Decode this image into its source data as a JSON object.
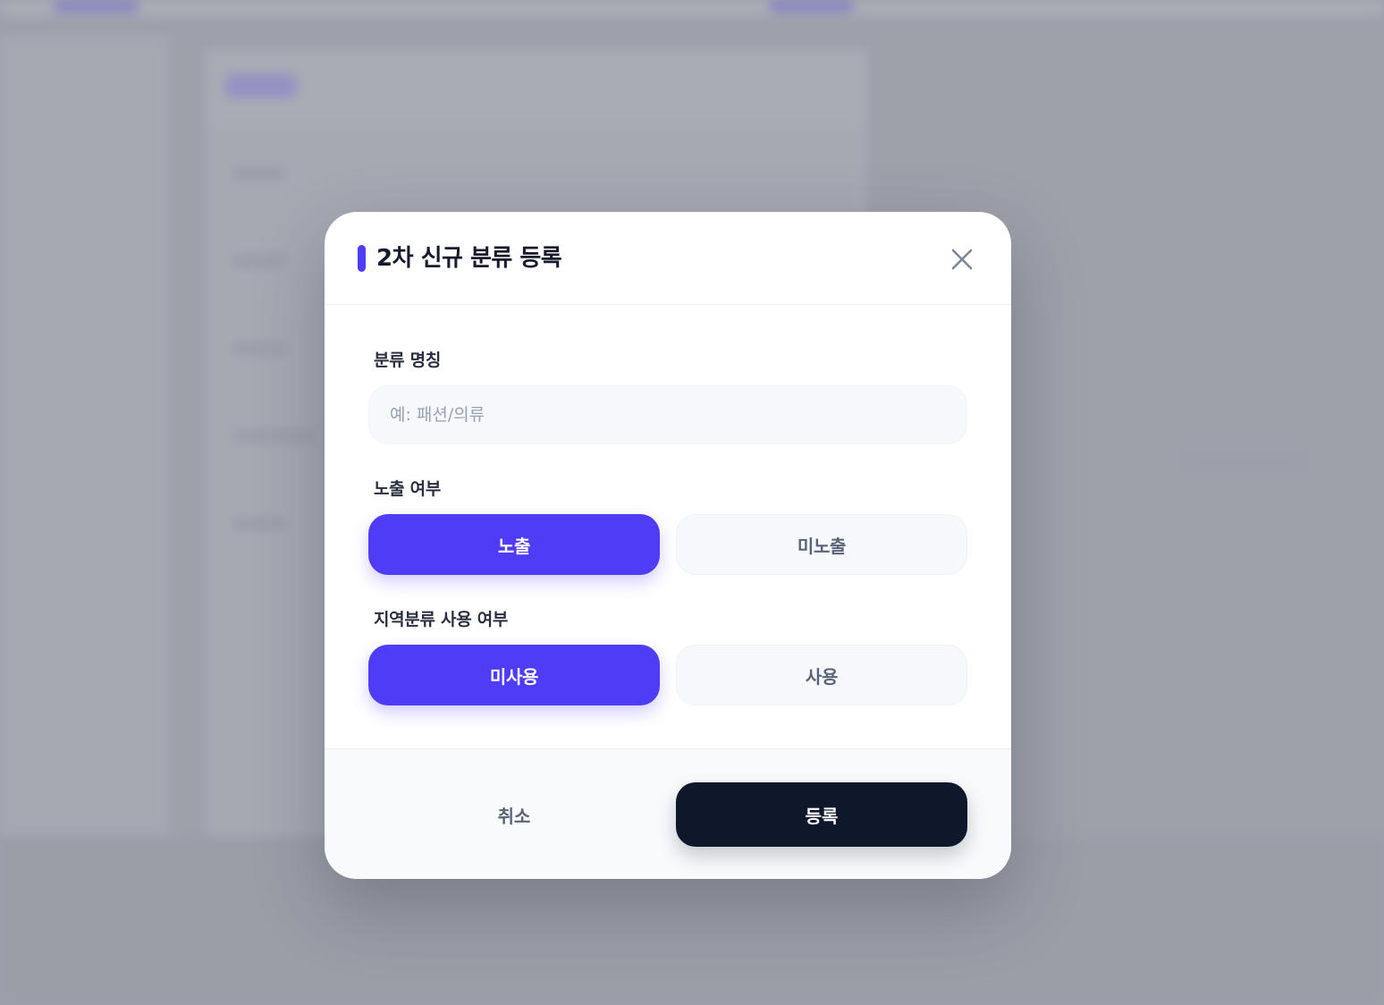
{
  "modal": {
    "title": "2차 신규 분류 등록",
    "close_icon": "close-icon"
  },
  "fields": {
    "category_name": {
      "label": "분류 명칭",
      "value": "",
      "placeholder": "예: 패션/의류"
    },
    "visibility": {
      "label": "노출 여부",
      "options": [
        "노출",
        "미노출"
      ],
      "selected": "노출"
    },
    "region_category": {
      "label": "지역분류 사용 여부",
      "options": [
        "미사용",
        "사용"
      ],
      "selected": "미사용"
    }
  },
  "footer": {
    "cancel_label": "취소",
    "submit_label": "등록"
  },
  "colors": {
    "accent": "#4f3cf6",
    "primary_dark": "#0f172a",
    "input_bg": "#f6f8fb",
    "backdrop": "#a3a6ae"
  }
}
